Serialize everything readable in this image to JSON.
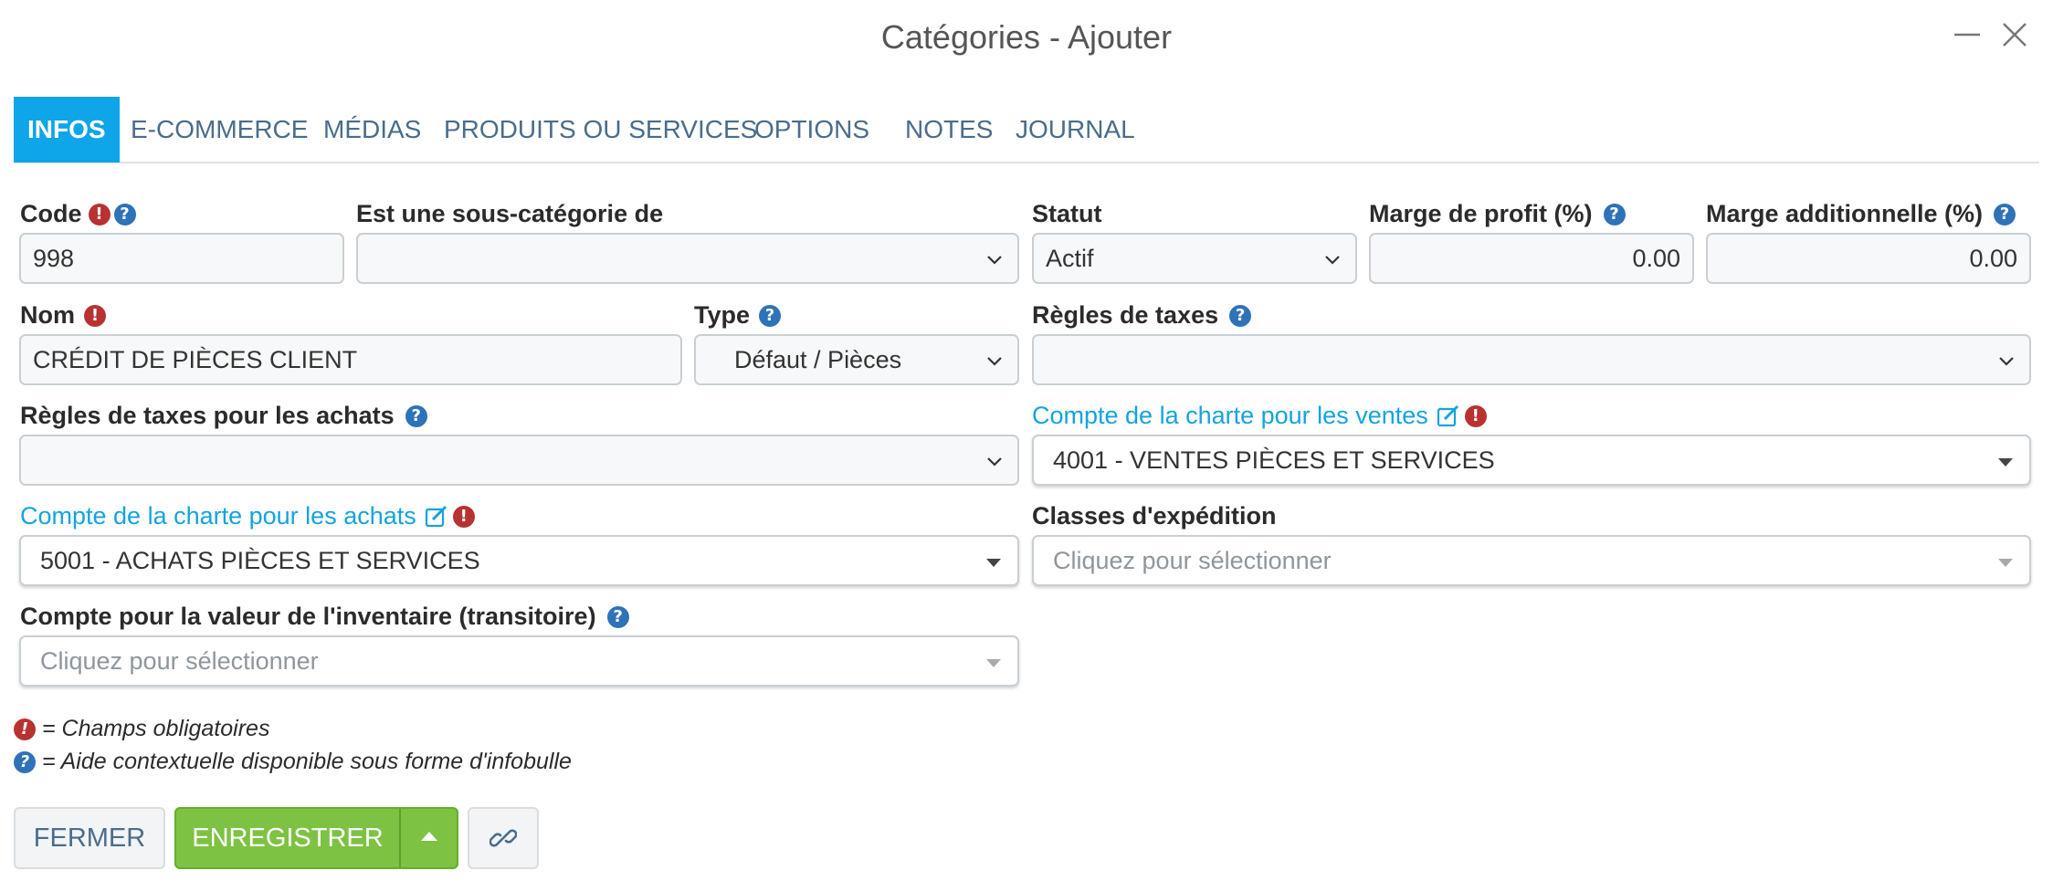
{
  "window": {
    "title": "Catégories - Ajouter"
  },
  "tabs": [
    "INFOS",
    "E-COMMERCE",
    "MÉDIAS",
    "PRODUITS OU SERVICES",
    "OPTIONS",
    "NOTES",
    "JOURNAL"
  ],
  "active_tab": "INFOS",
  "form": {
    "code": {
      "label": "Code",
      "value": "998"
    },
    "parent": {
      "label": "Est une sous-catégorie de",
      "value": ""
    },
    "statut": {
      "label": "Statut",
      "value": "Actif"
    },
    "marge_profit": {
      "label": "Marge de profit (%)",
      "value": "0.00"
    },
    "marge_add": {
      "label": "Marge additionnelle (%)",
      "value": "0.00"
    },
    "nom": {
      "label": "Nom",
      "value": "CRÉDIT DE PIÈCES CLIENT"
    },
    "type": {
      "label": "Type",
      "value": "Défaut / Pièces"
    },
    "regles_taxes": {
      "label": "Règles de taxes",
      "value": ""
    },
    "regles_taxes_achats": {
      "label": "Règles de taxes pour les achats",
      "value": ""
    },
    "compte_ventes": {
      "label": "Compte de la charte pour les ventes",
      "value": "4001 - VENTES PIÈCES ET SERVICES"
    },
    "compte_achats": {
      "label": "Compte de la charte pour les achats",
      "value": "5001 - ACHATS PIÈCES ET SERVICES"
    },
    "classes_expedition": {
      "label": "Classes d'expédition",
      "placeholder": "Cliquez pour sélectionner"
    },
    "compte_inventaire": {
      "label": "Compte pour la valeur de l'inventaire (transitoire)",
      "placeholder": "Cliquez pour sélectionner"
    }
  },
  "legend": {
    "required": "= Champs obligatoires",
    "help": "= Aide contextuelle disponible sous forme d'infobulle"
  },
  "buttons": {
    "close": "FERMER",
    "save": "ENREGISTRER"
  },
  "colors": {
    "accent": "#0ea5e9",
    "save": "#7dc242",
    "required_icon": "#b83232",
    "help_icon": "#2e72b8",
    "link_label": "#15a3dd"
  },
  "icons": [
    "minimize-icon",
    "close-icon",
    "required-icon",
    "help-icon",
    "edit-icon",
    "chevron-down-icon",
    "caret-down-icon",
    "caret-up-icon",
    "link-icon"
  ]
}
